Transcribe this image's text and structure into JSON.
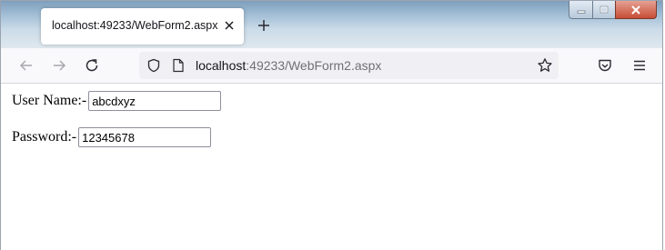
{
  "browser": {
    "tab": {
      "title": "localhost:49233/WebForm2.aspx",
      "close_icon": "close-icon"
    },
    "new_tab_icon": "plus-icon",
    "window_controls": [
      "minimize-icon",
      "maximize-icon",
      "close-icon"
    ],
    "address_bar": {
      "host": "localhost",
      "rest": ":49233/WebForm2.aspx"
    },
    "icons": {
      "back": "arrow-left-icon",
      "forward": "arrow-right-icon",
      "reload": "reload-icon",
      "shield": "shield-icon",
      "page": "page-icon",
      "bookmark": "star-icon",
      "pocket": "pocket-icon",
      "menu": "hamburger-menu-icon"
    }
  },
  "form": {
    "username_label": "User Name:-",
    "username_value": "abcdxyz",
    "password_label": "Password:-",
    "password_value": "12345678"
  }
}
